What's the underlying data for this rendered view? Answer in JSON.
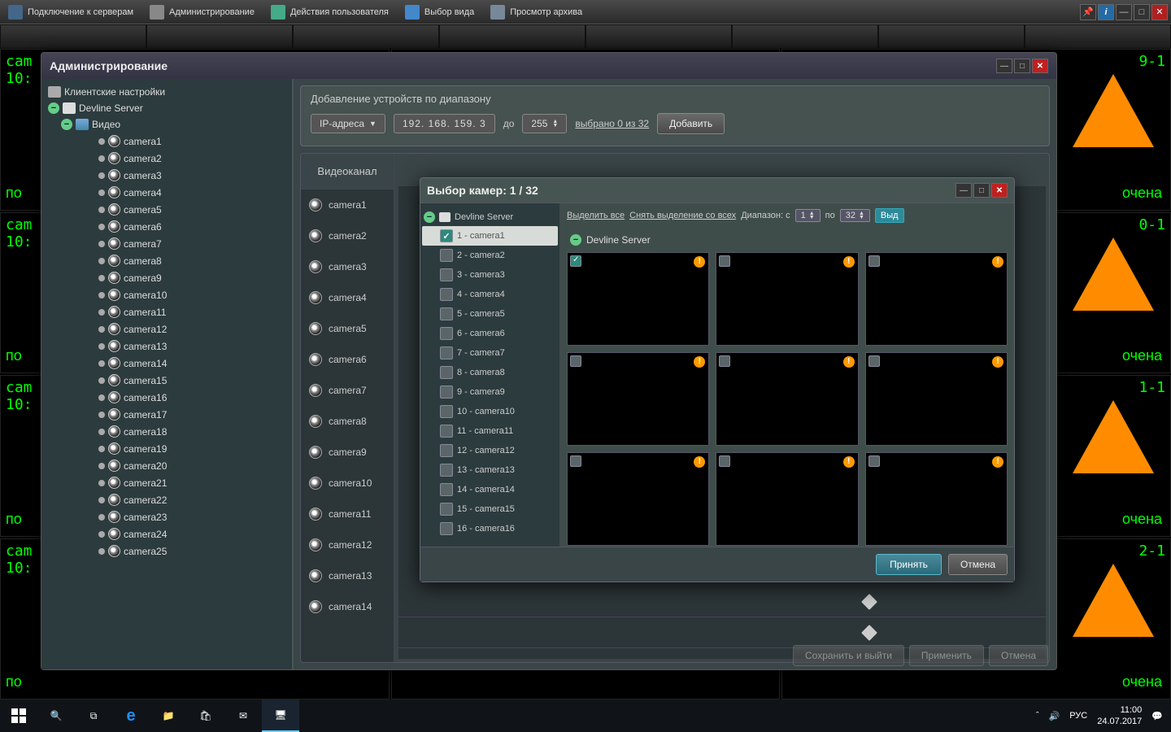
{
  "toolbar": {
    "items": [
      "Подключение к серверам",
      "Администрирование",
      "Действия пользователя",
      "Выбор вида",
      "Просмотр архива"
    ]
  },
  "bg_cells": {
    "label_prefix": "cam",
    "time": "10:",
    "right_labels": [
      "9-1",
      "0-1",
      "1-1",
      "2-1"
    ],
    "status_partial_right": "очена",
    "status_partial_left": "по"
  },
  "admin": {
    "title": "Администрирование",
    "tree": {
      "client": "Клиентские настройки",
      "server": "Devline Server",
      "video": "Видео",
      "cameras": [
        "camera1",
        "camera2",
        "camera3",
        "camera4",
        "camera5",
        "camera6",
        "camera7",
        "camera8",
        "camera9",
        "camera10",
        "camera11",
        "camera12",
        "camera13",
        "camera14",
        "camera15",
        "camera16",
        "camera17",
        "camera18",
        "camera19",
        "camera20",
        "camera21",
        "camera22",
        "camera23",
        "camera24",
        "camera25"
      ]
    },
    "range": {
      "title": "Добавление устройств по диапазону",
      "mode": "IP-адреса",
      "ip": "192. 168. 159.   3",
      "to_label": "до",
      "to_value": "255",
      "selected": "выбрано 0 из 32",
      "add": "Добавить"
    },
    "channels": {
      "header": "Видеоканал",
      "items": [
        "camera1",
        "camera2",
        "camera3",
        "camera4",
        "camera5",
        "camera6",
        "camera7",
        "camera8",
        "camera9",
        "camera10",
        "camera11",
        "camera12",
        "camera13",
        "camera14"
      ]
    },
    "footer": {
      "save": "Сохранить и выйти",
      "apply": "Применить",
      "cancel": "Отмена"
    }
  },
  "dialog": {
    "title": "Выбор камер: 1 / 32",
    "server": "Devline Server",
    "items": [
      {
        "label": "1 - camera1",
        "checked": true,
        "selected": true
      },
      {
        "label": "2 - camera2",
        "checked": false
      },
      {
        "label": "3 - camera3",
        "checked": false
      },
      {
        "label": "4 - camera4",
        "checked": false
      },
      {
        "label": "5 - camera5",
        "checked": false
      },
      {
        "label": "6 - camera6",
        "checked": false
      },
      {
        "label": "7 - camera7",
        "checked": false
      },
      {
        "label": "8 - camera8",
        "checked": false
      },
      {
        "label": "9 - camera9",
        "checked": false
      },
      {
        "label": "10 - camera10",
        "checked": false
      },
      {
        "label": "11 - camera11",
        "checked": false
      },
      {
        "label": "12 - camera12",
        "checked": false
      },
      {
        "label": "13 - camera13",
        "checked": false
      },
      {
        "label": "14 - camera14",
        "checked": false
      },
      {
        "label": "15 - camera15",
        "checked": false
      },
      {
        "label": "16 - camera16",
        "checked": false
      }
    ],
    "top": {
      "select_all": "Выделить все",
      "deselect_all": "Снять выделение со всех",
      "range_label": "Диапазон: с",
      "from": "1",
      "to_label": "по",
      "to": "32",
      "highlight": "Выд"
    },
    "group": "Devline Server",
    "thumbs": [
      {
        "checked": true
      },
      {
        "checked": false
      },
      {
        "checked": false
      },
      {
        "checked": false
      },
      {
        "checked": false
      },
      {
        "checked": false
      },
      {
        "checked": false
      },
      {
        "checked": false
      },
      {
        "checked": false
      }
    ],
    "ok": "Принять",
    "cancel": "Отмена"
  },
  "taskbar": {
    "lang": "РУС",
    "time": "11:00",
    "date": "24.07.2017"
  }
}
